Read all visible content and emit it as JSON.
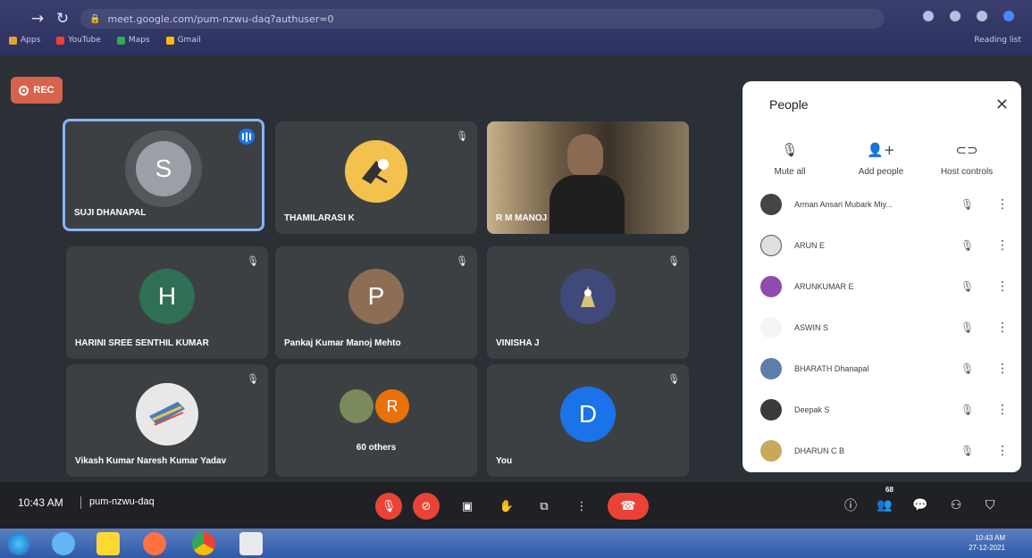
{
  "browser": {
    "url": "meet.google.com/pum-nzwu-daq?authuser=0",
    "bookmarks": [
      {
        "label": "Apps",
        "color": "#e8a13a"
      },
      {
        "label": "YouTube",
        "color": "#ea4335"
      },
      {
        "label": "Maps",
        "color": "#34a853"
      },
      {
        "label": "Gmail",
        "color": "#fbbc05"
      }
    ],
    "reading_list": "Reading list"
  },
  "recording": {
    "label": "REC"
  },
  "tiles": [
    {
      "name": "SUJI DHANAPAL",
      "initial": "S",
      "avatar_color": "#9aa0a6",
      "speaking": true,
      "muted": false
    },
    {
      "name": "THAMILARASI K",
      "initial": "",
      "avatar_color": "#f2c14e",
      "speaking": false,
      "muted": true
    },
    {
      "name": "R M MANOJ",
      "initial": "",
      "avatar_color": "",
      "speaking": false,
      "muted": false,
      "video": true
    },
    {
      "name": "HARINI SREE SENTHIL KUMAR",
      "initial": "H",
      "avatar_color": "#2e6f55",
      "speaking": false,
      "muted": true
    },
    {
      "name": "Pankaj Kumar Manoj Mehto",
      "initial": "P",
      "avatar_color": "#8d6e53",
      "speaking": false,
      "muted": true
    },
    {
      "name": "VINISHA J",
      "initial": "",
      "avatar_color": "#5c6bc0",
      "speaking": false,
      "muted": true
    },
    {
      "name": "Vikash Kumar Naresh Kumar Yadav",
      "initial": "",
      "avatar_color": "#4a7fb5",
      "speaking": false,
      "muted": true
    },
    {
      "name": "60 others",
      "initial": "R",
      "avatar_color": "#e8710a",
      "speaking": false,
      "muted": false
    },
    {
      "name": "You",
      "initial": "D",
      "avatar_color": "#1a73e8",
      "speaking": false,
      "muted": true
    }
  ],
  "people_panel": {
    "title": "People",
    "controls": [
      {
        "label": "Mute all",
        "icon": "mic-off-icon"
      },
      {
        "label": "Add people",
        "icon": "add-person-icon"
      },
      {
        "label": "Host controls",
        "icon": "toggle-icon"
      }
    ],
    "participants": [
      {
        "name": "Arman Ansari Mubark Miy...",
        "color": "#444"
      },
      {
        "name": "ARUN E",
        "color": "#e0e0e0"
      },
      {
        "name": "ARUNKUMAR E",
        "color": "#8e4bb0"
      },
      {
        "name": "ASWIN S",
        "color": "#f5f5f5"
      },
      {
        "name": "BHARATH Dhanapal",
        "color": "#5d7ea8"
      },
      {
        "name": "Deepak S",
        "color": "#3a3a3a"
      },
      {
        "name": "DHARUN C B",
        "color": "#c9a85a"
      }
    ]
  },
  "bottom_bar": {
    "time": "10:43 AM",
    "meeting_code": "pum-nzwu-daq",
    "people_count": "68"
  },
  "taskbar": {
    "time": "10:43 AM",
    "date": "27-12-2021"
  }
}
